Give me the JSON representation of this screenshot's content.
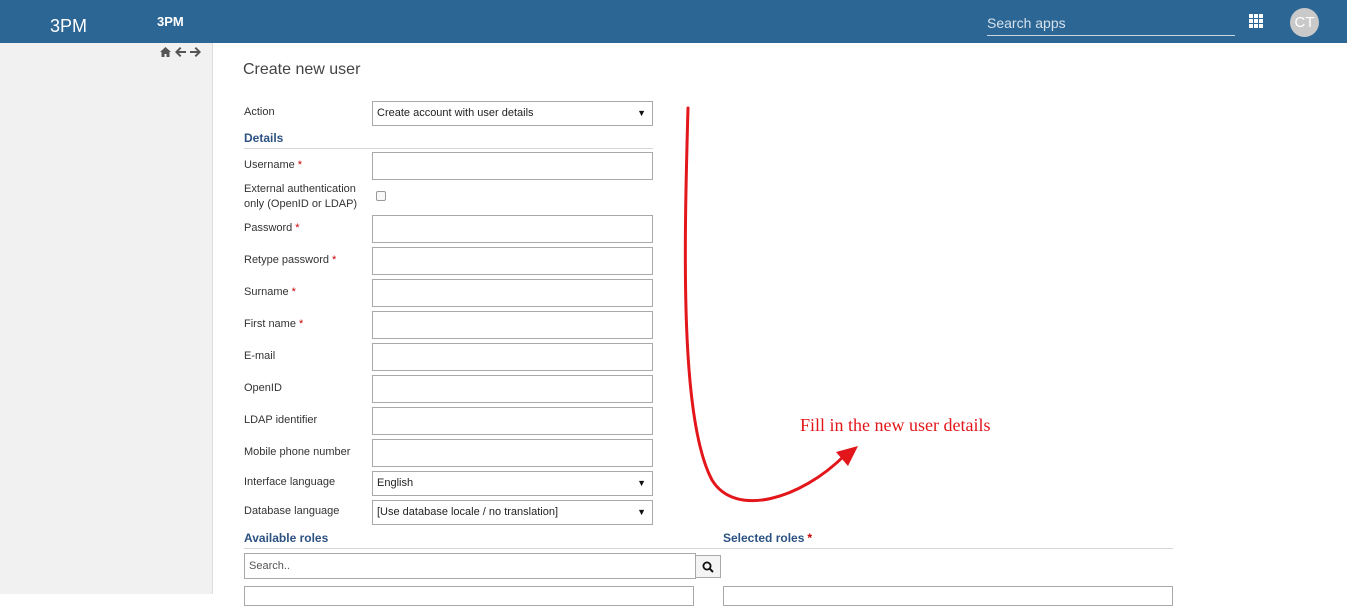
{
  "header": {
    "logo": "3PM",
    "app_name": "3PM",
    "search_placeholder": "Search apps",
    "avatar_initials": "CT"
  },
  "page_title": "Create new user",
  "form": {
    "action": {
      "label": "Action",
      "value": "Create account with user details"
    },
    "details_heading": "Details",
    "fields": {
      "username": "Username",
      "external_auth_line1": "External authentication",
      "external_auth_line2": "only (OpenID or LDAP)",
      "password": "Password",
      "retype_password": "Retype password",
      "surname": "Surname",
      "first_name": "First name",
      "email": "E-mail",
      "openid": "OpenID",
      "ldap": "LDAP identifier",
      "mobile": "Mobile phone number"
    },
    "required_mark": "*",
    "interface_language": {
      "label": "Interface language",
      "value": "English"
    },
    "database_language": {
      "label": "Database language",
      "value": "[Use database locale / no translation]"
    }
  },
  "roles": {
    "available_heading": "Available roles",
    "selected_heading": "Selected roles",
    "search_placeholder": "Search.."
  },
  "annotation": {
    "text": "Fill in the new user details",
    "color": "#e3161b"
  },
  "colors": {
    "header_bg": "#2c6694",
    "section_heading": "#2c5282"
  }
}
